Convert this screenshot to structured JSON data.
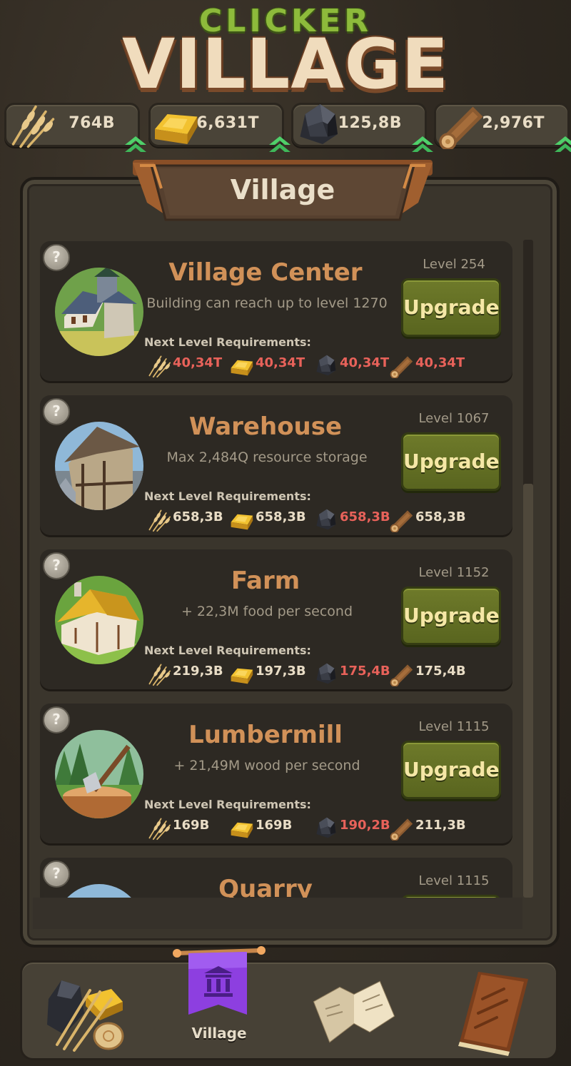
{
  "game": {
    "title_top": "CLICKER",
    "title_main": "VILLAGE"
  },
  "resources": [
    {
      "name": "wheat",
      "icon": "wheat-icon",
      "value": "764B"
    },
    {
      "name": "gold",
      "icon": "gold-bar-icon",
      "value": "6,631T"
    },
    {
      "name": "coal",
      "icon": "coal-icon",
      "value": "125,8B"
    },
    {
      "name": "wood",
      "icon": "log-icon",
      "value": "2,976T"
    }
  ],
  "panel": {
    "title": "Village",
    "requirements_label": "Next Level Requirements:",
    "upgrade_label": "Upgrade",
    "help_label": "?"
  },
  "buildings": [
    {
      "name": "Village Center",
      "description": "Building can reach up to level 1270",
      "level": "Level 254",
      "requirements": [
        {
          "resource": "wheat",
          "value": "40,34T",
          "insufficient": true
        },
        {
          "resource": "gold",
          "value": "40,34T",
          "insufficient": true
        },
        {
          "resource": "coal",
          "value": "40,34T",
          "insufficient": true
        },
        {
          "resource": "wood",
          "value": "40,34T",
          "insufficient": true
        }
      ]
    },
    {
      "name": "Warehouse",
      "description": "Max 2,484Q resource storage",
      "level": "Level 1067",
      "requirements": [
        {
          "resource": "wheat",
          "value": "658,3B",
          "insufficient": false
        },
        {
          "resource": "gold",
          "value": "658,3B",
          "insufficient": false
        },
        {
          "resource": "coal",
          "value": "658,3B",
          "insufficient": true
        },
        {
          "resource": "wood",
          "value": "658,3B",
          "insufficient": false
        }
      ]
    },
    {
      "name": "Farm",
      "description": "+ 22,3M food per second",
      "level": "Level 1152",
      "requirements": [
        {
          "resource": "wheat",
          "value": "219,3B",
          "insufficient": false
        },
        {
          "resource": "gold",
          "value": "197,3B",
          "insufficient": false
        },
        {
          "resource": "coal",
          "value": "175,4B",
          "insufficient": true
        },
        {
          "resource": "wood",
          "value": "175,4B",
          "insufficient": false
        }
      ]
    },
    {
      "name": "Lumbermill",
      "description": "+ 21,49M wood per second",
      "level": "Level 1115",
      "requirements": [
        {
          "resource": "wheat",
          "value": "169B",
          "insufficient": false
        },
        {
          "resource": "gold",
          "value": "169B",
          "insufficient": false
        },
        {
          "resource": "coal",
          "value": "190,2B",
          "insufficient": true
        },
        {
          "resource": "wood",
          "value": "211,3B",
          "insufficient": false
        }
      ]
    },
    {
      "name": "Quarry",
      "level": "Level 1115"
    }
  ],
  "nav": {
    "items": [
      {
        "name": "resources",
        "icon": "resources-icon"
      },
      {
        "name": "village",
        "icon": "village-banner-icon",
        "label": "Village",
        "active": true
      },
      {
        "name": "map",
        "icon": "map-icon"
      },
      {
        "name": "book",
        "icon": "book-icon"
      }
    ]
  },
  "colors": {
    "insufficient": "#e8625a",
    "title_accent": "#8dba3b",
    "building_name": "#d19158",
    "upgrade_button": "#6e7a2a"
  }
}
